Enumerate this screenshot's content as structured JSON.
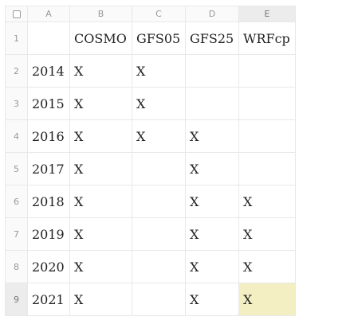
{
  "columns": [
    "A",
    "B",
    "C",
    "D",
    "E"
  ],
  "selected_column": "E",
  "selected_row": "9",
  "rows": [
    {
      "num": "1",
      "cells": [
        "",
        "COSMO",
        "GFS05",
        "GFS25",
        "WRFcp"
      ]
    },
    {
      "num": "2",
      "cells": [
        "2014",
        "X",
        "X",
        "",
        ""
      ]
    },
    {
      "num": "3",
      "cells": [
        "2015",
        "X",
        "X",
        "",
        ""
      ]
    },
    {
      "num": "4",
      "cells": [
        "2016",
        "X",
        "X",
        "X",
        ""
      ]
    },
    {
      "num": "5",
      "cells": [
        "2017",
        "X",
        "",
        "X",
        ""
      ]
    },
    {
      "num": "6",
      "cells": [
        "2018",
        "X",
        "",
        "X",
        "X"
      ]
    },
    {
      "num": "7",
      "cells": [
        "2019",
        "X",
        "",
        "X",
        "X"
      ]
    },
    {
      "num": "8",
      "cells": [
        "2020",
        "X",
        "",
        "X",
        "X"
      ]
    },
    {
      "num": "9",
      "cells": [
        "2021",
        "X",
        "",
        "X",
        "X"
      ]
    }
  ],
  "colors": {
    "selected_cell": "#f3efc3",
    "selected_header": "#ececec"
  }
}
